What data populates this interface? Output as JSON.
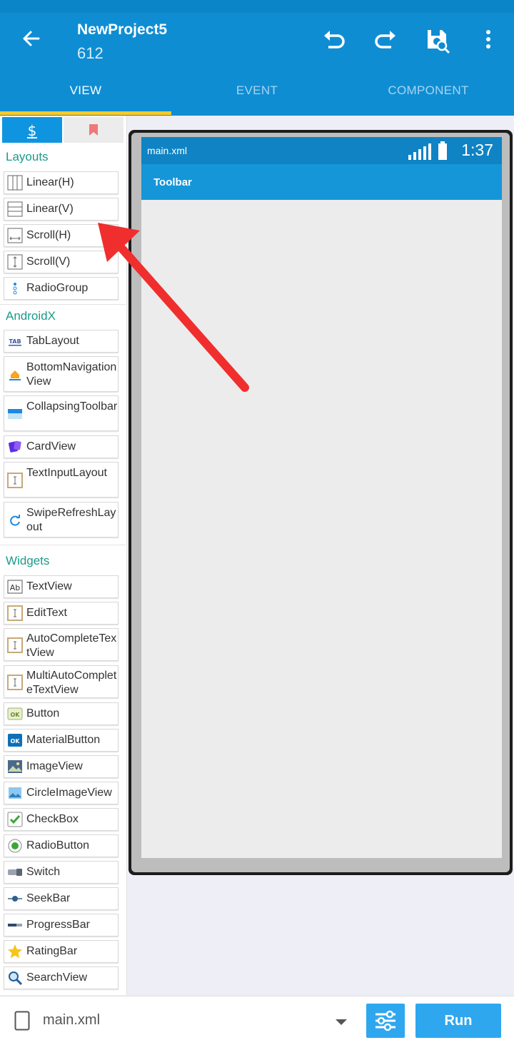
{
  "header": {
    "title": "NewProject5",
    "subtitle": "612",
    "tabs": [
      {
        "label": "VIEW",
        "active": true
      },
      {
        "label": "EVENT",
        "active": false
      },
      {
        "label": "COMPONENT",
        "active": false
      }
    ]
  },
  "palette": {
    "sections": {
      "layouts": "Layouts",
      "androidx": "AndroidX",
      "widgets": "Widgets"
    },
    "layouts": [
      "Linear(H)",
      "Linear(V)",
      "Scroll(H)",
      "Scroll(V)",
      "RadioGroup"
    ],
    "androidx": [
      "TabLayout",
      "BottomNavigationView",
      "CollapsingToolbar",
      "CardView",
      "TextInputLayout",
      "SwipeRefreshLayout"
    ],
    "widgets": [
      "TextView",
      "EditText",
      "AutoCompleteTextView",
      "MultiAutoCompleteTextView",
      "Button",
      "MaterialButton",
      "ImageView",
      "CircleImageView",
      "CheckBox",
      "RadioButton",
      "Switch",
      "SeekBar",
      "ProgressBar",
      "RatingBar",
      "SearchView"
    ]
  },
  "preview": {
    "file": "main.xml",
    "time": "1:37",
    "toolbar": "Toolbar"
  },
  "bottom": {
    "file": "main.xml",
    "run": "Run"
  },
  "colors": {
    "primary": "#0f8dd3",
    "accent": "#f7c928",
    "section_text": "#1a9b8b",
    "run_button": "#2fa7ef",
    "arrow": "#f02e2e"
  }
}
